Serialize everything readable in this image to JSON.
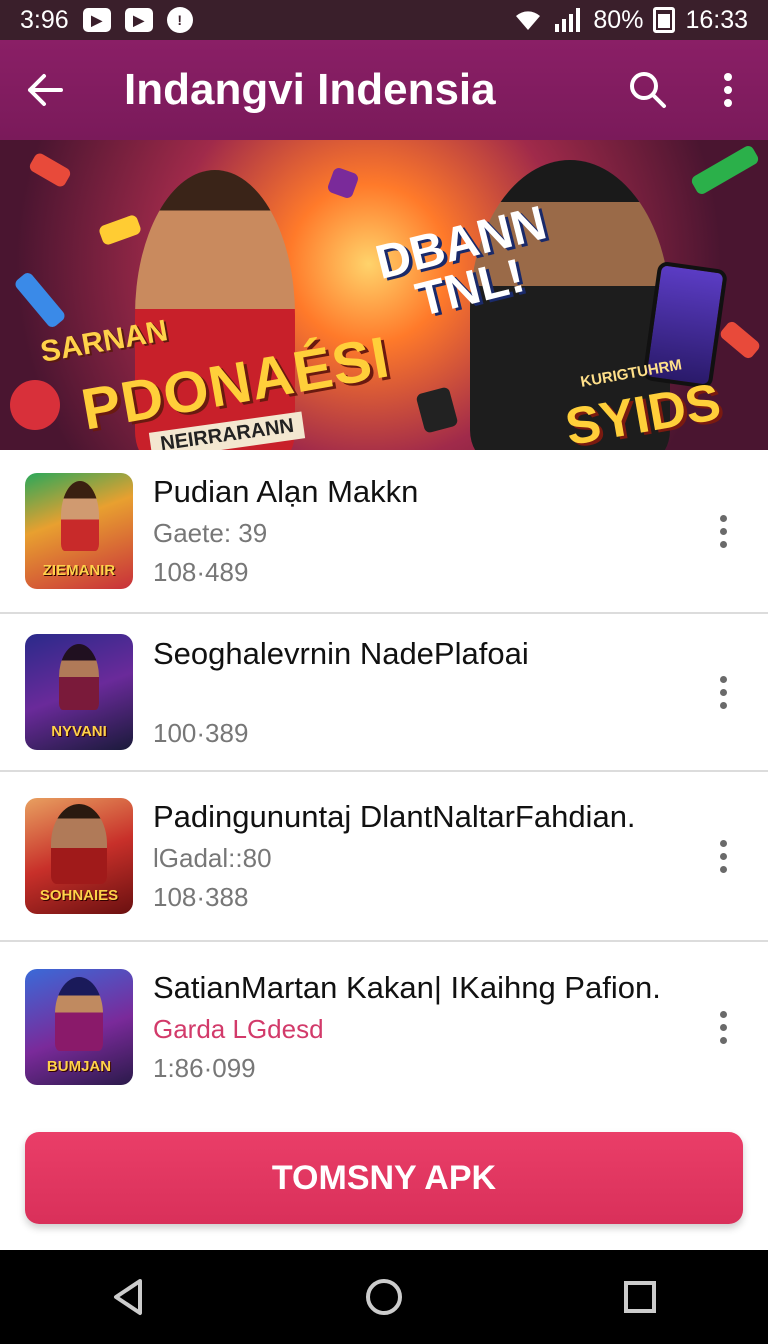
{
  "status": {
    "time_left": "3:96",
    "battery": "80%",
    "time_right": "16:33"
  },
  "app_bar": {
    "title": "Indangvi Indensia"
  },
  "banner": {
    "left_small": "SARNAN",
    "left_big": "PDONAÉSI",
    "left_sub": "NEIRRARANN",
    "center_line1": "DBANN",
    "center_line2": "TNL!",
    "right_small": "KURIGTUHRM",
    "right_big": "SYIDS"
  },
  "items": [
    {
      "title": "Pudian Alạn Makkn",
      "line2": "Gaete: 39",
      "line3": "108·489",
      "thumb_text": "ZIEMANIR"
    },
    {
      "title": "Seoghalevrnin NadePlafoai",
      "line2": "",
      "line3": "100·389",
      "thumb_text": "NYVANI"
    },
    {
      "title": "Padingununtaj DlantNaltarFahdian.",
      "line2": "lGadal::80",
      "line3": "108·388",
      "thumb_text": "SOHNAIES"
    },
    {
      "title": "SatianMartan Kakan| IKaihng Pafion.",
      "line2": "Garda LGdesd",
      "line3": "1:86·099",
      "thumb_text": "BUMJAN"
    }
  ],
  "install_button": "TOMSNY APK",
  "colors": {
    "app_bar": "#8a1f66",
    "accent": "#e23a64",
    "status_bar": "#3a1f2b"
  },
  "icons": [
    "back-arrow-icon",
    "search-icon",
    "more-vert-icon",
    "nav-back-icon",
    "nav-home-icon",
    "nav-recents-icon"
  ]
}
